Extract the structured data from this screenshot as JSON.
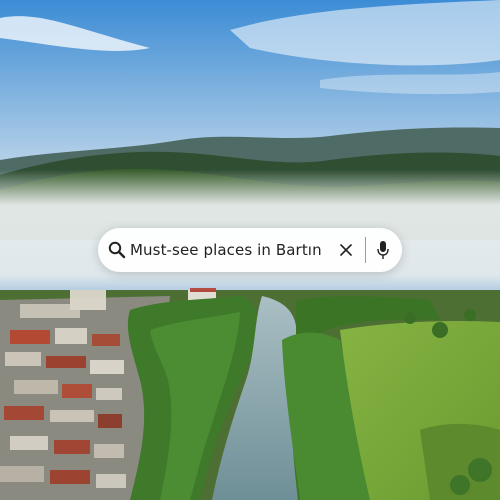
{
  "search": {
    "query": "Must-see places in Bartın"
  },
  "icons": {
    "search": "search-icon",
    "clear": "close-icon",
    "voice": "microphone-icon"
  },
  "colors": {
    "sky_top": "#3f8fd6",
    "sky_bottom": "#bcd6ec",
    "fog": "#e6ecef",
    "forest": "#2f5a1f",
    "river": "#7f9ea6",
    "field": "#7aa83a",
    "search_bar_bg": "#ffffff",
    "text": "#222222"
  }
}
